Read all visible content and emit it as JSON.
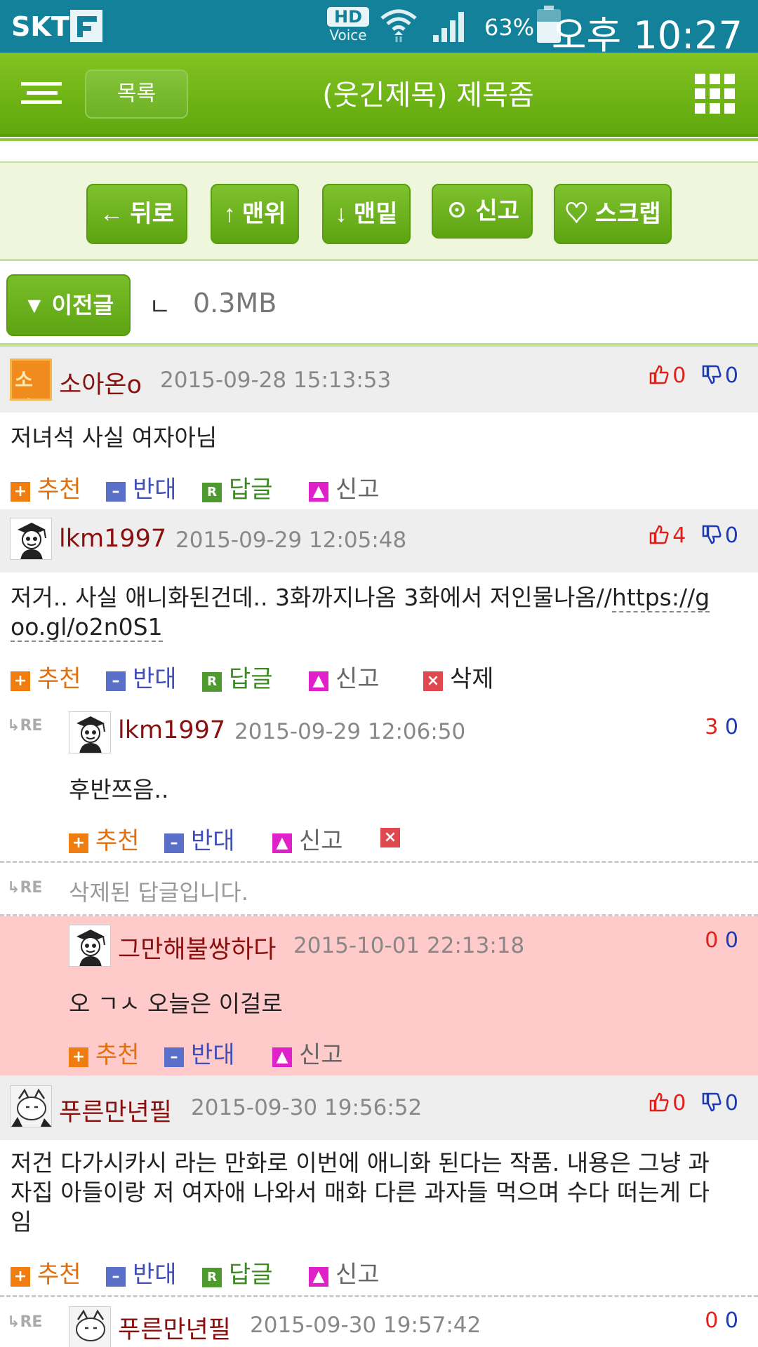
{
  "status_bar": {
    "carrier": "SKT",
    "hd": "HD",
    "voice": "Voice",
    "battery_pct": "63%",
    "battery_level": 0.63,
    "time": "오후 10:27"
  },
  "header": {
    "list_button": "목록",
    "title": "(웃긴제목) 제목좀",
    "accent": "#6db124"
  },
  "toolbar": {
    "back": "← 뒤로",
    "top": "↑ 맨위",
    "bottom": "↓ 맨밑",
    "report": "☉ 신고",
    "scrap": "♡ 스크랩"
  },
  "prev": {
    "button": "▼ 이전글",
    "mark": "ㄴ",
    "size": "0.3MB"
  },
  "actions": {
    "recommend": "추천",
    "oppose": "반대",
    "reply": "답글",
    "report": "신고",
    "delete": "삭제",
    "reply_icon": "R"
  },
  "re_label": "RE",
  "comments": [
    {
      "name": "소아온o",
      "avatar_text": "소아",
      "date": "2015-09-28 15:13:53",
      "up": "0",
      "down": "0",
      "body": "저녀석 사실 여자아님"
    },
    {
      "name": "lkm1997",
      "date": "2015-09-29 12:05:48",
      "up": "4",
      "down": "0",
      "body_text": "저거.. 사실 애니화된건데.. 3화까지나옴 3화에서 저인물나옴//",
      "body_link_1": "https://g",
      "body_link_2": "oo.gl/o2n0S1"
    },
    {
      "name": "lkm1997",
      "date": "2015-09-29 12:06:50",
      "up": "3",
      "down": "0",
      "body": "후반쯔음.."
    },
    {
      "deleted_text": "삭제된 답글입니다."
    },
    {
      "name": "그만해불쌍하다",
      "date": "2015-10-01 22:13:18",
      "up": "0",
      "down": "0",
      "body": "오 ㄱㅅ 오늘은 이걸로"
    },
    {
      "name": "푸른만년필",
      "date": "2015-09-30 19:56:52",
      "up": "0",
      "down": "0",
      "body_line_1": "저건 다가시카시 라는 만화로 이번에 애니화 된다는 작품. 내용은 그냥 과",
      "body_line_2": "자집 아들이랑 저 여자애 나와서 매화 다른 과자들 먹으며 수다 떠는게 다",
      "body_line_3": "임"
    },
    {
      "name": "푸른만년필",
      "date": "2015-09-30 19:57:42",
      "up": "0",
      "down": "0"
    }
  ]
}
